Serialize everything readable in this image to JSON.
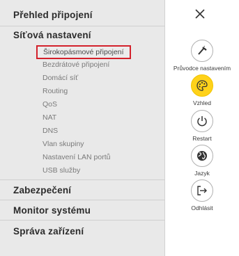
{
  "menu": {
    "overview": "Přehled připojení",
    "network_settings": "Síťová nastavení",
    "network_items": [
      "Širokopásmové připojení",
      "Bezdrátové připojení",
      "Domácí síť",
      "Routing",
      "QoS",
      "NAT",
      "DNS",
      "Vlan skupiny",
      "Nastavení LAN portů",
      "USB služby"
    ],
    "security": "Zabezpečení",
    "monitor": "Monitor systému",
    "device_management": "Správa zařízení"
  },
  "side": {
    "wizard_label": "Průvodce nastavením",
    "theme_label": "Vzhled",
    "restart_label": "Restart",
    "language_label": "Jazyk",
    "logout_label": "Odhlásit"
  },
  "colors": {
    "highlight_border": "#d3212b",
    "theme_accent": "#ffd21a"
  }
}
